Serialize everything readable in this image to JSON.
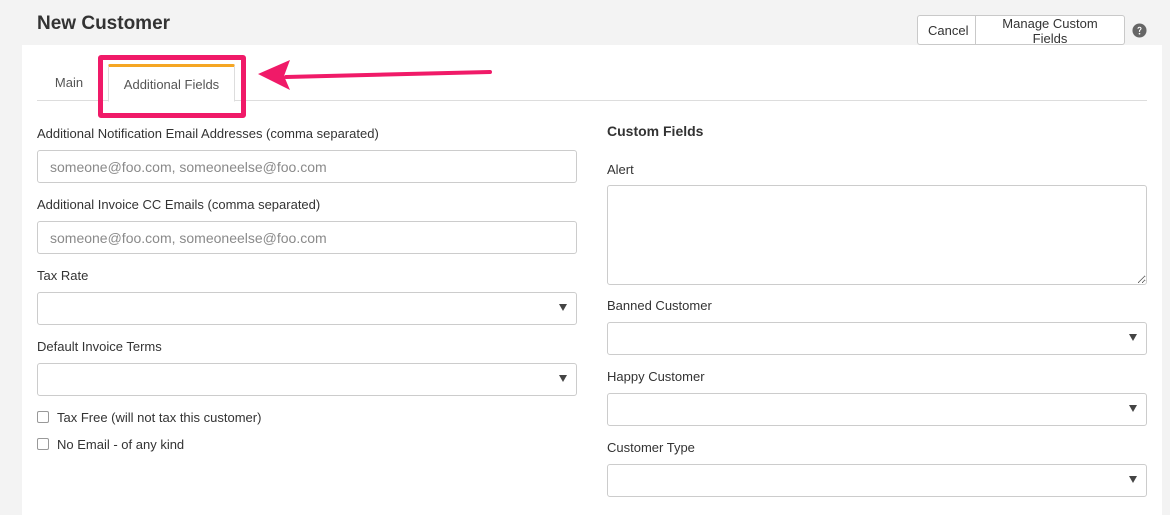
{
  "page": {
    "title": "New Customer"
  },
  "toolbar": {
    "cancel_label": "Cancel",
    "manage_fields_label": "Manage Custom Fields"
  },
  "tabs": [
    {
      "label": "Main",
      "active": false
    },
    {
      "label": "Additional Fields",
      "active": true
    }
  ],
  "form": {
    "notification_emails": {
      "label": "Additional Notification Email Addresses (comma separated)",
      "value": "",
      "placeholder": "someone@foo.com, someoneelse@foo.com"
    },
    "invoice_cc_emails": {
      "label": "Additional Invoice CC Emails (comma separated)",
      "value": "",
      "placeholder": "someone@foo.com, someoneelse@foo.com"
    },
    "tax_rate": {
      "label": "Tax Rate",
      "selected": ""
    },
    "default_invoice_terms": {
      "label": "Default Invoice Terms",
      "selected": ""
    },
    "tax_free": {
      "label": "Tax Free (will not tax this customer)",
      "checked": false
    },
    "no_email": {
      "label": "No Email - of any kind",
      "checked": false
    }
  },
  "custom_fields": {
    "title": "Custom Fields",
    "alert": {
      "label": "Alert",
      "value": ""
    },
    "banned_customer": {
      "label": "Banned Customer",
      "selected": ""
    },
    "happy_customer": {
      "label": "Happy Customer",
      "selected": ""
    },
    "customer_type": {
      "label": "Customer Type",
      "selected": ""
    }
  },
  "colors": {
    "accent_tab": "#f5a623",
    "highlight": "#f01a68",
    "background": "#f3f3f3",
    "panel": "#ffffff"
  },
  "icons": {
    "help": "question-circle-icon",
    "select_caret": "caret-down-icon",
    "annotation_arrow": "arrow-left-icon"
  }
}
